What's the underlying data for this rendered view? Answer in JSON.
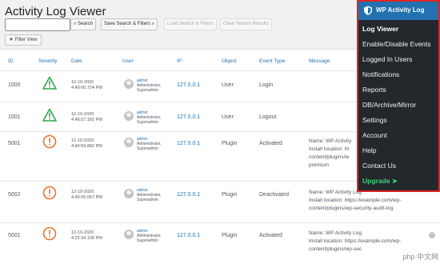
{
  "page": {
    "title": "Activity Log Viewer",
    "search_placeholder": "",
    "buttons": {
      "search": "Search",
      "save_search": "Save Search & Filters",
      "load_search": "Load Search & Filters",
      "clear_search": "Clear Search Results",
      "filter_view": "Filter View"
    }
  },
  "table": {
    "headers": [
      "ID",
      "Severity",
      "Date",
      "User",
      "IP",
      "Object",
      "Event Type",
      "Message"
    ],
    "rows": [
      {
        "id": "1000",
        "severity": "warning",
        "date": "12-10-2020",
        "time": "4:49:00.724 PM",
        "user": "admin",
        "role1": "Administrator,",
        "role2": "Superadmin",
        "ip": "127.0.0.1",
        "object": "User",
        "event": "Login",
        "msg_lines": []
      },
      {
        "id": "1001",
        "severity": "warning",
        "date": "12-10-2020",
        "time": "4:48:57.181 PM",
        "user": "admin",
        "role1": "Administrator,",
        "role2": "Superadmin",
        "ip": "127.0.0.1",
        "object": "User",
        "event": "Logout",
        "msg_lines": []
      },
      {
        "id": "5001",
        "severity": "critical",
        "date": "12-10-2020",
        "time": "4:40:59.892 PM",
        "user": "admin",
        "role1": "Administrator,",
        "role2": "Superadmin",
        "ip": "127.0.0.1",
        "object": "Plugin",
        "event": "Activated",
        "msg_lines": [
          "Name: WP Activity",
          "Install location: ht",
          "content/plugins/w",
          "premium"
        ]
      },
      {
        "id": "5002",
        "severity": "critical",
        "date": "12-10-2020",
        "time": "4:40:05.067 PM",
        "user": "admin",
        "role1": "Administrator,",
        "role2": "Superadmin",
        "ip": "127.0.0.1",
        "object": "Plugin",
        "event": "Deactivated",
        "msg_lines": [
          "Name: WP Activity Log",
          "Install location: https://example.com/wp-",
          "content/plugins/wp-security-audit-log"
        ]
      },
      {
        "id": "5001",
        "severity": "critical",
        "date": "12-10-2020",
        "time": "4:22:34.130 PM",
        "user": "admin",
        "role1": "Administrator,",
        "role2": "Superadmin",
        "ip": "127.0.0.1",
        "object": "Plugin",
        "event": "Activated",
        "msg_lines": [
          "Name: WP Activity Log",
          "Install location: https://example.com/wp-",
          "content/plugins/wp-sec"
        ]
      }
    ]
  },
  "menu": {
    "header": "WP Activity Log",
    "items": [
      "Log Viewer",
      "Enable/Disable Events",
      "Logged In Users",
      "Notifications",
      "Reports",
      "DB/Archive/Mirror",
      "Settings",
      "Account",
      "Help",
      "Contact Us",
      "Upgrade ➤"
    ]
  },
  "watermark": "php 中文网",
  "colors": {
    "warning": "#2ea44f",
    "critical": "#e8722c",
    "menu_border": "#e02424",
    "menu_head": "#2271b1",
    "upgrade": "#3bd275"
  }
}
